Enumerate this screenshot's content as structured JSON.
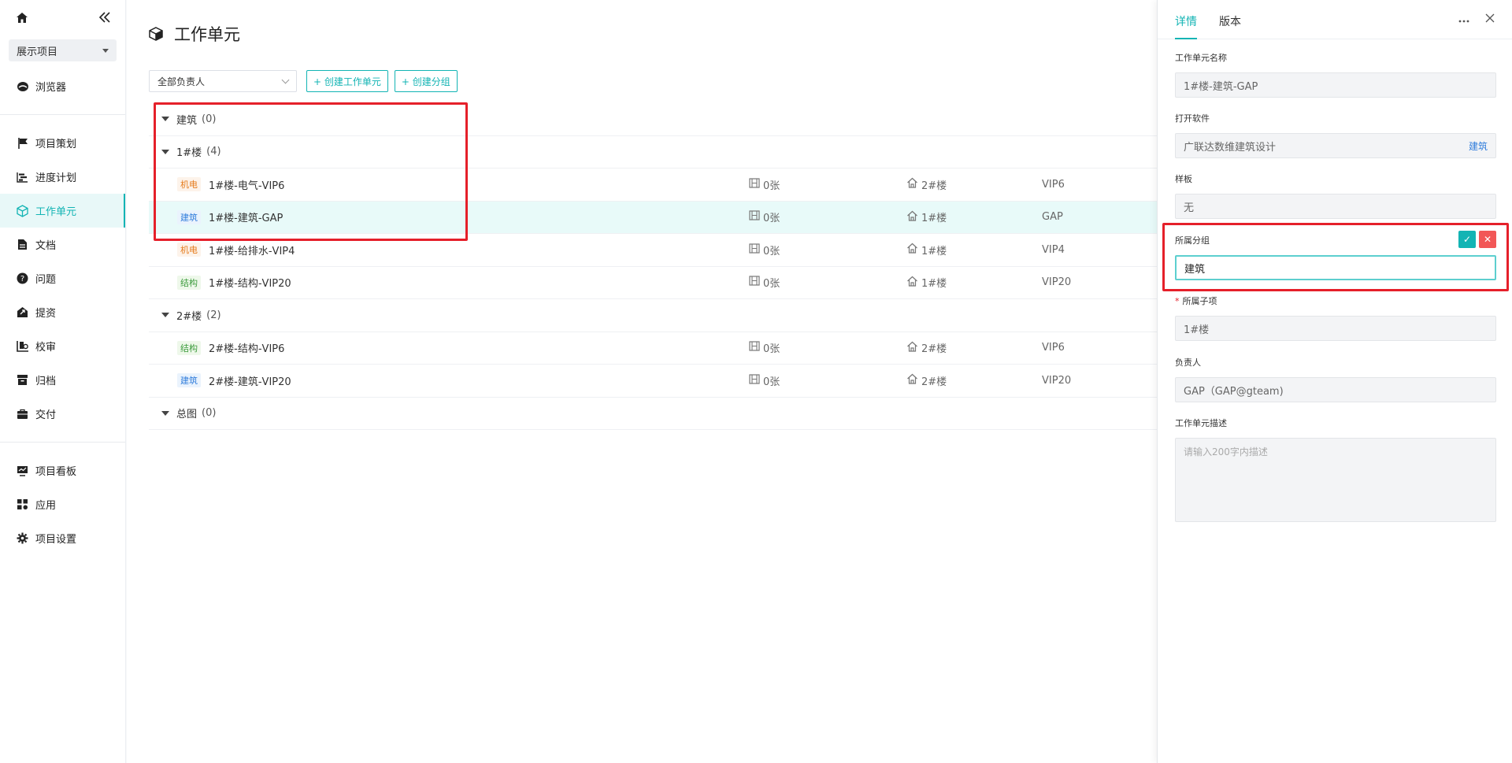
{
  "sidebar": {
    "project_select": "展示项目",
    "items": [
      {
        "label": "浏览器",
        "icon": "browser-icon"
      },
      {
        "label": "项目策划",
        "icon": "flag-icon"
      },
      {
        "label": "进度计划",
        "icon": "gantt-icon"
      },
      {
        "label": "工作单元",
        "icon": "cube-icon",
        "active": true
      },
      {
        "label": "文档",
        "icon": "document-icon"
      },
      {
        "label": "问题",
        "icon": "question-icon"
      },
      {
        "label": "提资",
        "icon": "submit-icon"
      },
      {
        "label": "校审",
        "icon": "review-icon"
      },
      {
        "label": "归档",
        "icon": "archive-icon"
      },
      {
        "label": "交付",
        "icon": "briefcase-icon"
      },
      {
        "label": "项目看板",
        "icon": "dashboard-icon"
      },
      {
        "label": "应用",
        "icon": "apps-icon"
      },
      {
        "label": "项目设置",
        "icon": "gear-icon"
      }
    ]
  },
  "main": {
    "title": "工作单元",
    "filter": "全部负责人",
    "create_unit_btn": "+ 创建工作单元",
    "create_group_btn": "+ 创建分组",
    "groups": [
      {
        "name": "建筑",
        "count": "(0)"
      },
      {
        "name": "1#楼",
        "count": "(4)"
      },
      {
        "name": "2#楼",
        "count": "(2)"
      },
      {
        "name": "总图",
        "count": "(0)"
      }
    ],
    "items": [
      {
        "tag": "机电",
        "tag_color": "#e57a1a",
        "name": "1#楼-电气-VIP6",
        "sheets": "0张",
        "building": "2#楼",
        "version": "VIP6"
      },
      {
        "tag": "建筑",
        "tag_color": "#2f7cdb",
        "name": "1#楼-建筑-GAP",
        "sheets": "0张",
        "building": "1#楼",
        "version": "GAP"
      },
      {
        "tag": "机电",
        "tag_color": "#e57a1a",
        "name": "1#楼-给排水-VIP4",
        "sheets": "0张",
        "building": "1#楼",
        "version": "VIP4"
      },
      {
        "tag": "结构",
        "tag_color": "#3c9b3c",
        "name": "1#楼-结构-VIP20",
        "sheets": "0张",
        "building": "1#楼",
        "version": "VIP20"
      },
      {
        "tag": "结构",
        "tag_color": "#3c9b3c",
        "name": "2#楼-结构-VIP6",
        "sheets": "0张",
        "building": "2#楼",
        "version": "VIP6"
      },
      {
        "tag": "建筑",
        "tag_color": "#2f7cdb",
        "name": "2#楼-建筑-VIP20",
        "sheets": "0张",
        "building": "2#楼",
        "version": "VIP20"
      }
    ]
  },
  "panel": {
    "tabs": [
      "详情",
      "版本"
    ],
    "unit_name_label": "工作单元名称",
    "unit_name_value": "1#楼-建筑-GAP",
    "software_label": "打开软件",
    "software_value": "广联达数维建筑设计",
    "software_side": "建筑",
    "template_label": "样板",
    "template_value": "无",
    "group_label": "所属分组",
    "group_value": "建筑",
    "subitem_label": "所属子项",
    "subitem_required": "*",
    "subitem_value": "1#楼",
    "owner_label": "负责人",
    "owner_value": "GAP（GAP@gteam)",
    "desc_label": "工作单元描述",
    "desc_placeholder": "请输入200字内描述",
    "ok_icon": "✓",
    "cancel_icon": "✕"
  },
  "colors": {
    "accent": "#13b4b4",
    "highlight": "#e5202a"
  }
}
